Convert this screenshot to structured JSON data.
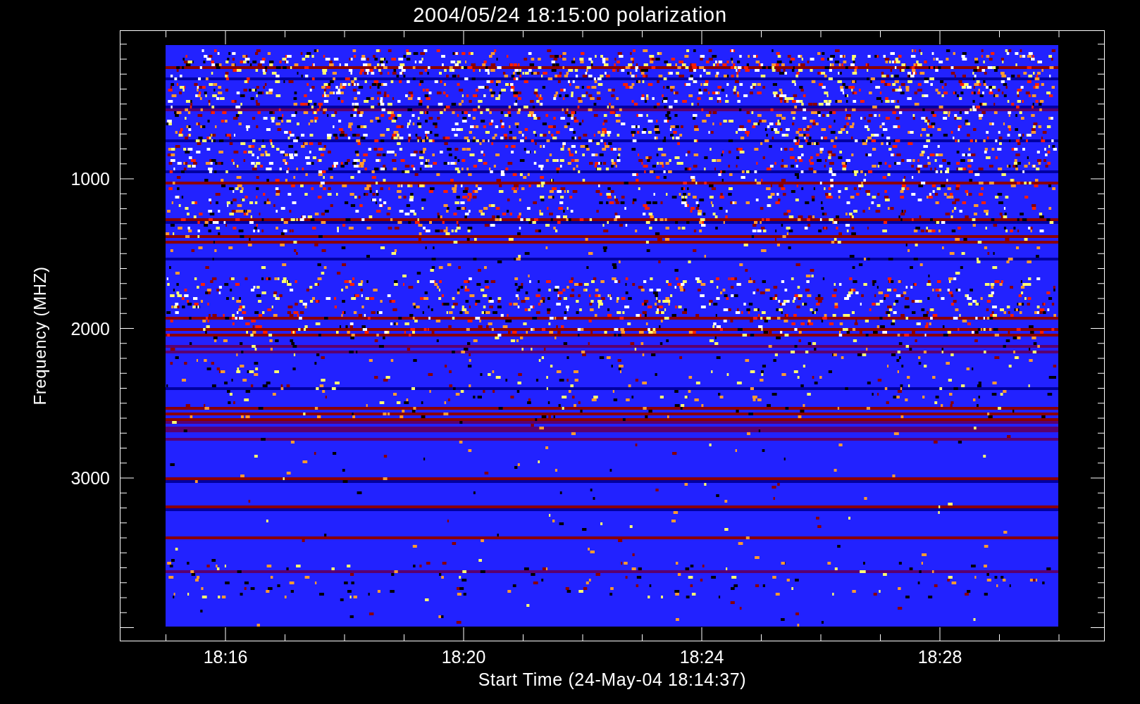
{
  "title": "2004/05/24 18:15:00 polarization",
  "y_axis": {
    "label": "Frequency (MHZ)",
    "ticks": [
      "1000",
      "2000",
      "3000"
    ]
  },
  "x_axis": {
    "label": "Start Time (24-May-04 18:14:37)",
    "ticks": [
      "18:16",
      "18:20",
      "18:24",
      "18:28"
    ]
  }
}
